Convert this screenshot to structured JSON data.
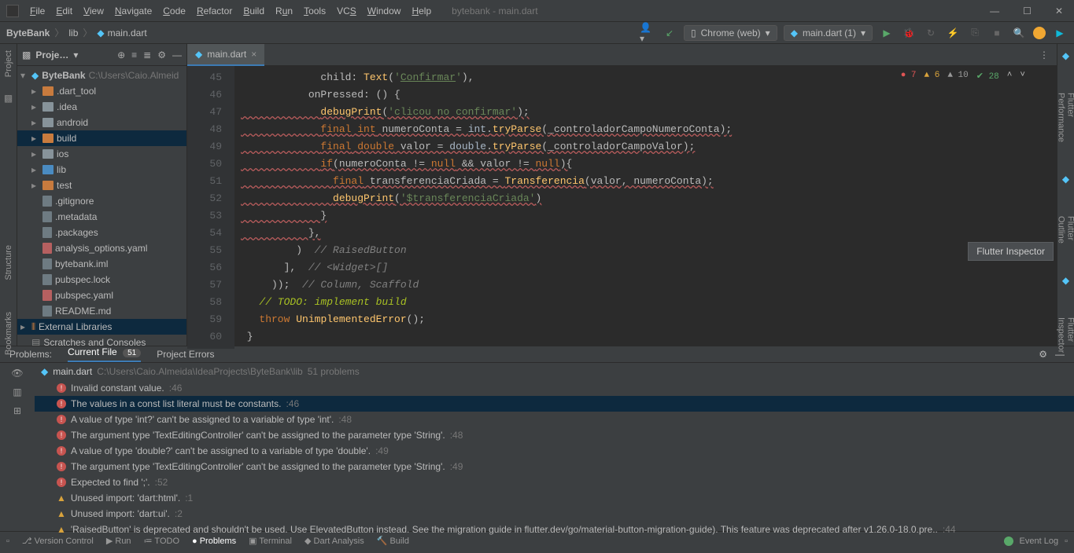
{
  "window": {
    "title": "bytebank - main.dart"
  },
  "menu": [
    "File",
    "Edit",
    "View",
    "Navigate",
    "Code",
    "Refactor",
    "Build",
    "Run",
    "Tools",
    "VCS",
    "Window",
    "Help"
  ],
  "breadcrumbs": {
    "project": "ByteBank",
    "folder": "lib",
    "file": "main.dart"
  },
  "run_config": {
    "device": "Chrome (web)",
    "config": "main.dart (1)"
  },
  "project_panel": {
    "title": "Proje…",
    "root": {
      "name": "ByteBank",
      "path": "C:\\Users\\Caio.Almeid"
    },
    "folders": [
      {
        "name": ".dart_tool",
        "kind": "orange"
      },
      {
        "name": ".idea",
        "kind": "gray"
      },
      {
        "name": "android",
        "kind": "gray"
      },
      {
        "name": "build",
        "kind": "orange",
        "sel": true
      },
      {
        "name": "ios",
        "kind": "gray"
      },
      {
        "name": "lib",
        "kind": "blue"
      },
      {
        "name": "test",
        "kind": "orange"
      }
    ],
    "files": [
      {
        "name": ".gitignore"
      },
      {
        "name": ".metadata"
      },
      {
        "name": ".packages"
      },
      {
        "name": "analysis_options.yaml",
        "yml": true
      },
      {
        "name": "bytebank.iml"
      },
      {
        "name": "pubspec.lock"
      },
      {
        "name": "pubspec.yaml",
        "yml": true
      },
      {
        "name": "README.md"
      }
    ],
    "ext_lib": "External Libraries",
    "scratches": "Scratches and Consoles"
  },
  "editor": {
    "tab": "main.dart",
    "lines_start": 45,
    "indicators": {
      "errors": 7,
      "warnings": 6,
      "weak": 10,
      "ok": 28
    },
    "code": [
      {
        "n": 45,
        "html": "             child: <span class='fn'>Text</span>(<span class='str'>'<u>Confirmar</u>'</span>),"
      },
      {
        "n": 46,
        "html": "           onPressed: () {"
      },
      {
        "n": 47,
        "html": "             <span class='fn'>debugPrint</span>(<span class='str'>'clicou no confirmar'</span>);",
        "err": true
      },
      {
        "n": 48,
        "html": "             <span class='kw'>final</span> <span class='kw'>int</span> numeroConta = <span class='type'>int</span>.<span class='fn'>tryParse</span>(_controladorCampoNumeroConta);",
        "err": true
      },
      {
        "n": 49,
        "html": "             <span class='kw'>final</span> <span class='kw'>double</span> valor = <span class='type'>double</span>.<span class='fn'>tryParse</span>(_controladorCampoValor);",
        "err": true
      },
      {
        "n": 50,
        "html": "             <span class='kw'>if</span>(numeroConta != <span class='kw'>null</span> && valor != <span class='kw'>null</span>){",
        "err": true
      },
      {
        "n": 51,
        "html": "               <span class='kw'>final</span> transferenciaCriada = <span class='fn'>Transferencia</span>(valor, numeroConta);",
        "err": true
      },
      {
        "n": 52,
        "html": "               <span class='fn'>debugPrint</span>(<span class='str'>'$transferenciaCriada'</span>)",
        "err": true
      },
      {
        "n": 53,
        "html": "             }",
        "err": true
      },
      {
        "n": 54,
        "html": "           },",
        "err": true
      },
      {
        "n": 55,
        "html": "         )  <span class='comment'>// RaisedButton</span>"
      },
      {
        "n": 56,
        "html": "       ],  <span class='comment'>// &lt;Widget&gt;[]</span>"
      },
      {
        "n": 57,
        "html": "     ));  <span class='comment'>// Column, Scaffold</span>"
      },
      {
        "n": 58,
        "html": "   <span class='todo'>// TODO: implement build</span>"
      },
      {
        "n": 59,
        "html": "   <span class='kw'>throw</span> <span class='fn'>UnimplementedError</span>();"
      },
      {
        "n": 60,
        "html": " }"
      }
    ]
  },
  "tooltip": "Flutter Inspector",
  "right_tools": [
    "Flutter Performance",
    "Flutter Outline",
    "Flutter Inspector"
  ],
  "left_tools": [
    "Project",
    "Structure",
    "Bookmarks"
  ],
  "problems": {
    "tabs": {
      "a": "Problems:",
      "b": "Current File",
      "count": "51",
      "c": "Project Errors"
    },
    "file": {
      "name": "main.dart",
      "path": "C:\\Users\\Caio.Almeida\\IdeaProjects\\ByteBank\\lib",
      "count": "51 problems"
    },
    "items": [
      {
        "t": "err",
        "msg": "Invalid constant value.",
        "loc": ":46"
      },
      {
        "t": "err",
        "msg": "The values in a const list literal must be constants.",
        "loc": ":46",
        "sel": true
      },
      {
        "t": "err",
        "msg": "A value of type 'int?' can't be assigned to a variable of type 'int'.",
        "loc": ":48"
      },
      {
        "t": "err",
        "msg": "The argument type 'TextEditingController' can't be assigned to the parameter type 'String'.",
        "loc": ":48"
      },
      {
        "t": "err",
        "msg": "A value of type 'double?' can't be assigned to a variable of type 'double'.",
        "loc": ":49"
      },
      {
        "t": "err",
        "msg": "The argument type 'TextEditingController' can't be assigned to the parameter type 'String'.",
        "loc": ":49"
      },
      {
        "t": "err",
        "msg": "Expected to find ';'.",
        "loc": ":52"
      },
      {
        "t": "warn",
        "msg": "Unused import: 'dart:html'.",
        "loc": ":1"
      },
      {
        "t": "warn",
        "msg": "Unused import: 'dart:ui'.",
        "loc": ":2"
      },
      {
        "t": "warn",
        "msg": "'RaisedButton' is deprecated and shouldn't be used. Use ElevatedButton instead. See the migration guide in flutter.dev/go/material-button-migration-guide). This feature was deprecated after v1.26.0-18.0.pre..",
        "loc": ":44"
      }
    ]
  },
  "statusbar": {
    "items": [
      "Version Control",
      "Run",
      "TODO",
      "Problems",
      "Terminal",
      "Dart Analysis",
      "Build"
    ],
    "active": "Problems",
    "event_log": "Event Log"
  }
}
